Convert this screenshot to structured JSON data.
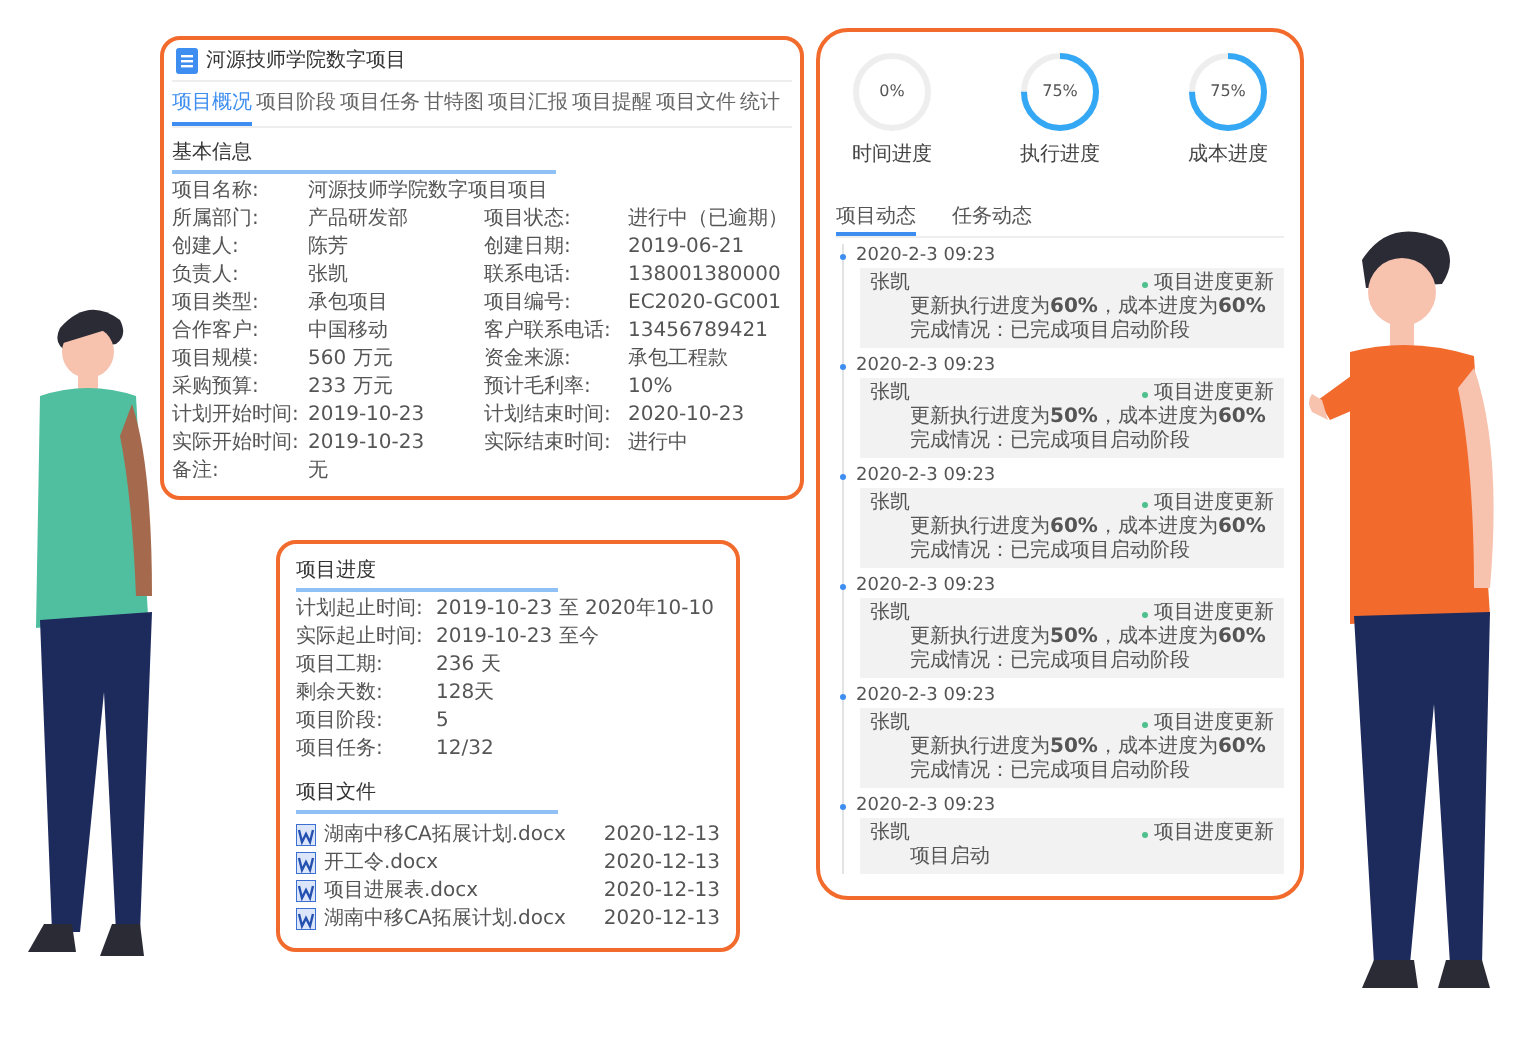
{
  "project_card": {
    "title": "河源技师学院数字项目",
    "tabs": [
      {
        "label": "项目概况",
        "selected": true
      },
      {
        "label": "项目阶段",
        "selected": false
      },
      {
        "label": "项目任务",
        "selected": false
      },
      {
        "label": "甘特图",
        "selected": false
      },
      {
        "label": "项目汇报",
        "selected": false
      },
      {
        "label": "项目提醒",
        "selected": false
      },
      {
        "label": "项目文件",
        "selected": false
      },
      {
        "label": "统计",
        "selected": false
      }
    ],
    "section": "基本信息",
    "rows": [
      [
        {
          "label": "项目名称:",
          "value": "河源技师学院数字项目项目"
        }
      ],
      [
        {
          "label": "所属部门:",
          "value": "产品研发部"
        },
        {
          "label": "项目状态:",
          "value": "进行中（已逾期）"
        }
      ],
      [
        {
          "label": "创建人:",
          "value": "陈芳"
        },
        {
          "label": "创建日期:",
          "value": "2019-06-21"
        }
      ],
      [
        {
          "label": "负责人:",
          "value": "张凯"
        },
        {
          "label": "联系电话:",
          "value": "138001380000"
        }
      ],
      [
        {
          "label": "项目类型:",
          "value": "承包项目"
        },
        {
          "label": "项目编号:",
          "value": "EC2020-GC001"
        }
      ],
      [
        {
          "label": "合作客户:",
          "value": "中国移动"
        },
        {
          "label": "客户联系电话:",
          "value": "13456789421"
        }
      ],
      [
        {
          "label": "项目规模:",
          "value": "560 万元"
        },
        {
          "label": "资金来源:",
          "value": "承包工程款"
        }
      ],
      [
        {
          "label": "采购预算:",
          "value": "233 万元"
        },
        {
          "label": "预计毛利率:",
          "value": "10%"
        }
      ],
      [
        {
          "label": "计划开始时间:",
          "value": "2019-10-23"
        },
        {
          "label": "计划结束时间:",
          "value": "2020-10-23"
        }
      ],
      [
        {
          "label": "实际开始时间:",
          "value": "2019-10-23"
        },
        {
          "label": "实际结束时间:",
          "value": "进行中"
        }
      ],
      [
        {
          "label": "备注:",
          "value": "无"
        }
      ]
    ]
  },
  "schedule_card": {
    "title": "项目进度",
    "rows": [
      {
        "label": "计划起止时间:",
        "value": "2019-10-23 至 2020年10-10"
      },
      {
        "label": "实际起止时间:",
        "value": "2019-10-23 至今"
      },
      {
        "label": "项目工期:",
        "value": "236 天"
      },
      {
        "label": "剩余天数:",
        "value": "128天"
      },
      {
        "label": "项目阶段:",
        "value": "5"
      },
      {
        "label": "项目任务:",
        "value": "12/32"
      }
    ],
    "files_title": "项目文件",
    "files": [
      {
        "name": "湖南中移CA拓展计划.docx",
        "date": "2020-12-13"
      },
      {
        "name": "开工令.docx",
        "date": "2020-12-13"
      },
      {
        "name": "项目进展表.docx",
        "date": "2020-12-13"
      },
      {
        "name": "湖南中移CA拓展计划.docx",
        "date": "2020-12-13"
      }
    ]
  },
  "progress_card": {
    "gauges": [
      {
        "label": "时间进度",
        "reading": "0%",
        "level": 0
      },
      {
        "label": "执行进度",
        "reading": "75%",
        "level": 0.75
      },
      {
        "label": "成本进度",
        "reading": "75%",
        "level": 0.75
      }
    ],
    "tabs": [
      {
        "label": "项目动态",
        "selected": true
      },
      {
        "label": "任务动态",
        "selected": false
      }
    ],
    "entries": [
      {
        "time": "2020-2-3 09:23",
        "author": "张凯",
        "lines": [
          "更新执行进度为**60%**，成本进度为**60%**",
          "完成情况：已完成项目启动阶段"
        ],
        "tag": "项目进度更新"
      },
      {
        "time": "2020-2-3 09:23",
        "author": "张凯",
        "lines": [
          "更新执行进度为**50%**，成本进度为**60%**",
          "完成情况：已完成项目启动阶段"
        ],
        "tag": "项目进度更新"
      },
      {
        "time": "2020-2-3 09:23",
        "author": "张凯",
        "lines": [
          "更新执行进度为**60%**，成本进度为**60%**",
          "完成情况：已完成项目启动阶段"
        ],
        "tag": "项目进度更新"
      },
      {
        "time": "2020-2-3 09:23",
        "author": "张凯",
        "lines": [
          "更新执行进度为**50%**，成本进度为**60%**",
          "完成情况：已完成项目启动阶段"
        ],
        "tag": "项目进度更新"
      },
      {
        "time": "2020-2-3 09:23",
        "author": "张凯",
        "lines": [
          "更新执行进度为**50%**，成本进度为**60%**",
          "完成情况：已完成项目启动阶段"
        ],
        "tag": "项目进度更新"
      },
      {
        "time": "2020-2-3 09:23",
        "author": "张凯",
        "lines": [
          "项目启动"
        ],
        "tag": "项目进度更新"
      }
    ]
  }
}
